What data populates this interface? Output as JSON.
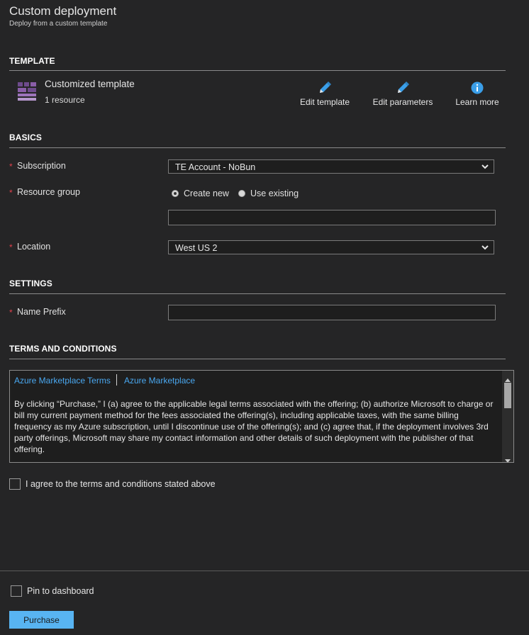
{
  "header": {
    "title": "Custom deployment",
    "subtitle": "Deploy from a custom template"
  },
  "template": {
    "section_title": "TEMPLATE",
    "name": "Customized template",
    "resources": "1 resource",
    "actions": [
      {
        "label": "Edit template",
        "icon": "pencil-icon"
      },
      {
        "label": "Edit parameters",
        "icon": "pencil-icon"
      },
      {
        "label": "Learn more",
        "icon": "info-icon"
      }
    ]
  },
  "basics": {
    "section_title": "BASICS",
    "subscription_label": "Subscription",
    "subscription_value": "TE Account - NoBun",
    "resource_group_label": "Resource group",
    "rg_option_create": "Create new",
    "rg_option_existing": "Use existing",
    "rg_selected": "Create new",
    "rg_name_value": "",
    "location_label": "Location",
    "location_value": "West US 2",
    "required_mark": "*"
  },
  "settings": {
    "section_title": "SETTINGS",
    "name_prefix_label": "Name Prefix",
    "name_prefix_value": ""
  },
  "terms": {
    "section_title": "TERMS AND CONDITIONS",
    "link1": "Azure Marketplace Terms",
    "link2": "Azure Marketplace",
    "body": "By clicking “Purchase,” I (a) agree to the applicable legal terms associated with the offering; (b) authorize Microsoft to charge or bill my current payment method for the fees associated the offering(s), including applicable taxes, with the same billing frequency as my Azure subscription, until I discontinue use of the offering(s); and (c) agree that, if the deployment involves 3rd party offerings, Microsoft may share my contact information and other details of such deployment with the publisher of that offering.",
    "agree_label": "I agree to the terms and conditions stated above",
    "agree_checked": false
  },
  "footer": {
    "pin_label": "Pin to dashboard",
    "pin_checked": false,
    "purchase_label": "Purchase"
  },
  "colors": {
    "background": "#252526",
    "accent": "#58b4f2",
    "link": "#4aa8f0",
    "required": "#e0404c",
    "template_icon": "#8a5ea8"
  }
}
